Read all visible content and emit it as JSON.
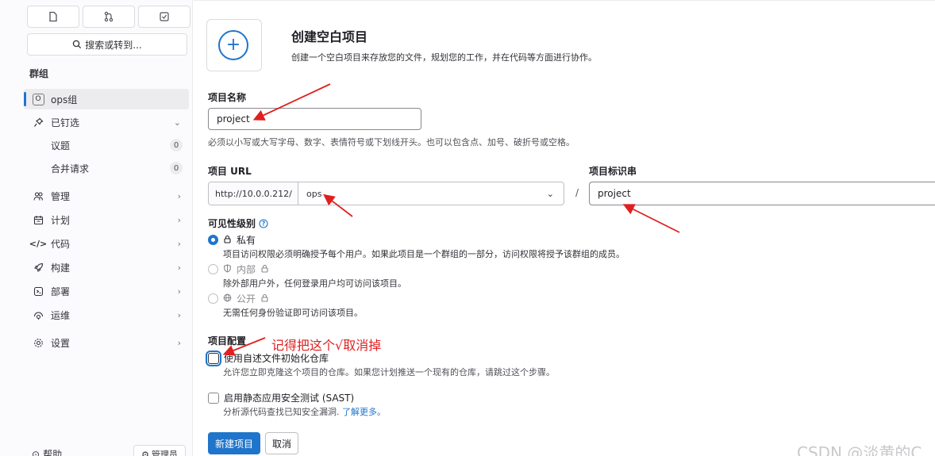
{
  "sidebar": {
    "search_label": "搜索或转到...",
    "group_heading": "群组",
    "group_item": {
      "avatar": "O",
      "label": "ops组"
    },
    "pinned_label": "已钉选",
    "pinned_items": [
      {
        "label": "议题",
        "count": "0"
      },
      {
        "label": "合并请求",
        "count": "0"
      }
    ],
    "nav": [
      {
        "label": "管理",
        "icon": "users-icon"
      },
      {
        "label": "计划",
        "icon": "calendar-icon"
      },
      {
        "label": "代码",
        "icon": "code-icon"
      },
      {
        "label": "构建",
        "icon": "rocket-icon"
      },
      {
        "label": "部署",
        "icon": "deploy-icon"
      },
      {
        "label": "运维",
        "icon": "monitor-icon"
      },
      {
        "label": "设置",
        "icon": "gear-icon"
      }
    ],
    "help_label": "帮助",
    "admin_label": "管理员"
  },
  "header": {
    "title": "创建空白项目",
    "description": "创建一个空白项目来存放您的文件，规划您的工作，并在代码等方面进行协作。"
  },
  "form": {
    "project_name_label": "项目名称",
    "project_name_value": "project",
    "project_name_help": "必须以小写或大写字母、数字、表情符号或下划线开头。也可以包含点、加号、破折号或空格。",
    "project_url_label": "项目 URL",
    "url_prefix": "http://10.0.0.212/",
    "namespace_value": "ops",
    "slash": "/",
    "slug_label": "项目标识串",
    "slug_value": "project",
    "visibility_label": "可见性级别",
    "visibility": [
      {
        "label": "私有",
        "desc": "项目访问权限必须明确授予每个用户。如果此项目是一个群组的一部分，访问权限将授予该群组的成员。",
        "selected": true
      },
      {
        "label": "内部",
        "desc": "除外部用户外，任何登录用户均可访问该项目。",
        "selected": false
      },
      {
        "label": "公开",
        "desc": "无需任何身份验证即可访问该项目。",
        "selected": false
      }
    ],
    "config_label": "项目配置",
    "init_readme_label": "使用自述文件初始化仓库",
    "init_readme_desc": "允许您立即克隆这个项目的仓库。如果您计划推送一个现有的仓库，请跳过这个步骤。",
    "sast_label": "启用静态应用安全测试 (SAST)",
    "sast_desc": "分析源代码查找已知安全漏洞.",
    "learn_more": "了解更多。",
    "create_button": "新建项目",
    "cancel_button": "取消"
  },
  "annotation_text": "记得把这个√取消掉",
  "watermark": "CSDN @淡黄的C",
  "colors": {
    "accent": "#1f75cb",
    "annotation": "#e02020"
  }
}
